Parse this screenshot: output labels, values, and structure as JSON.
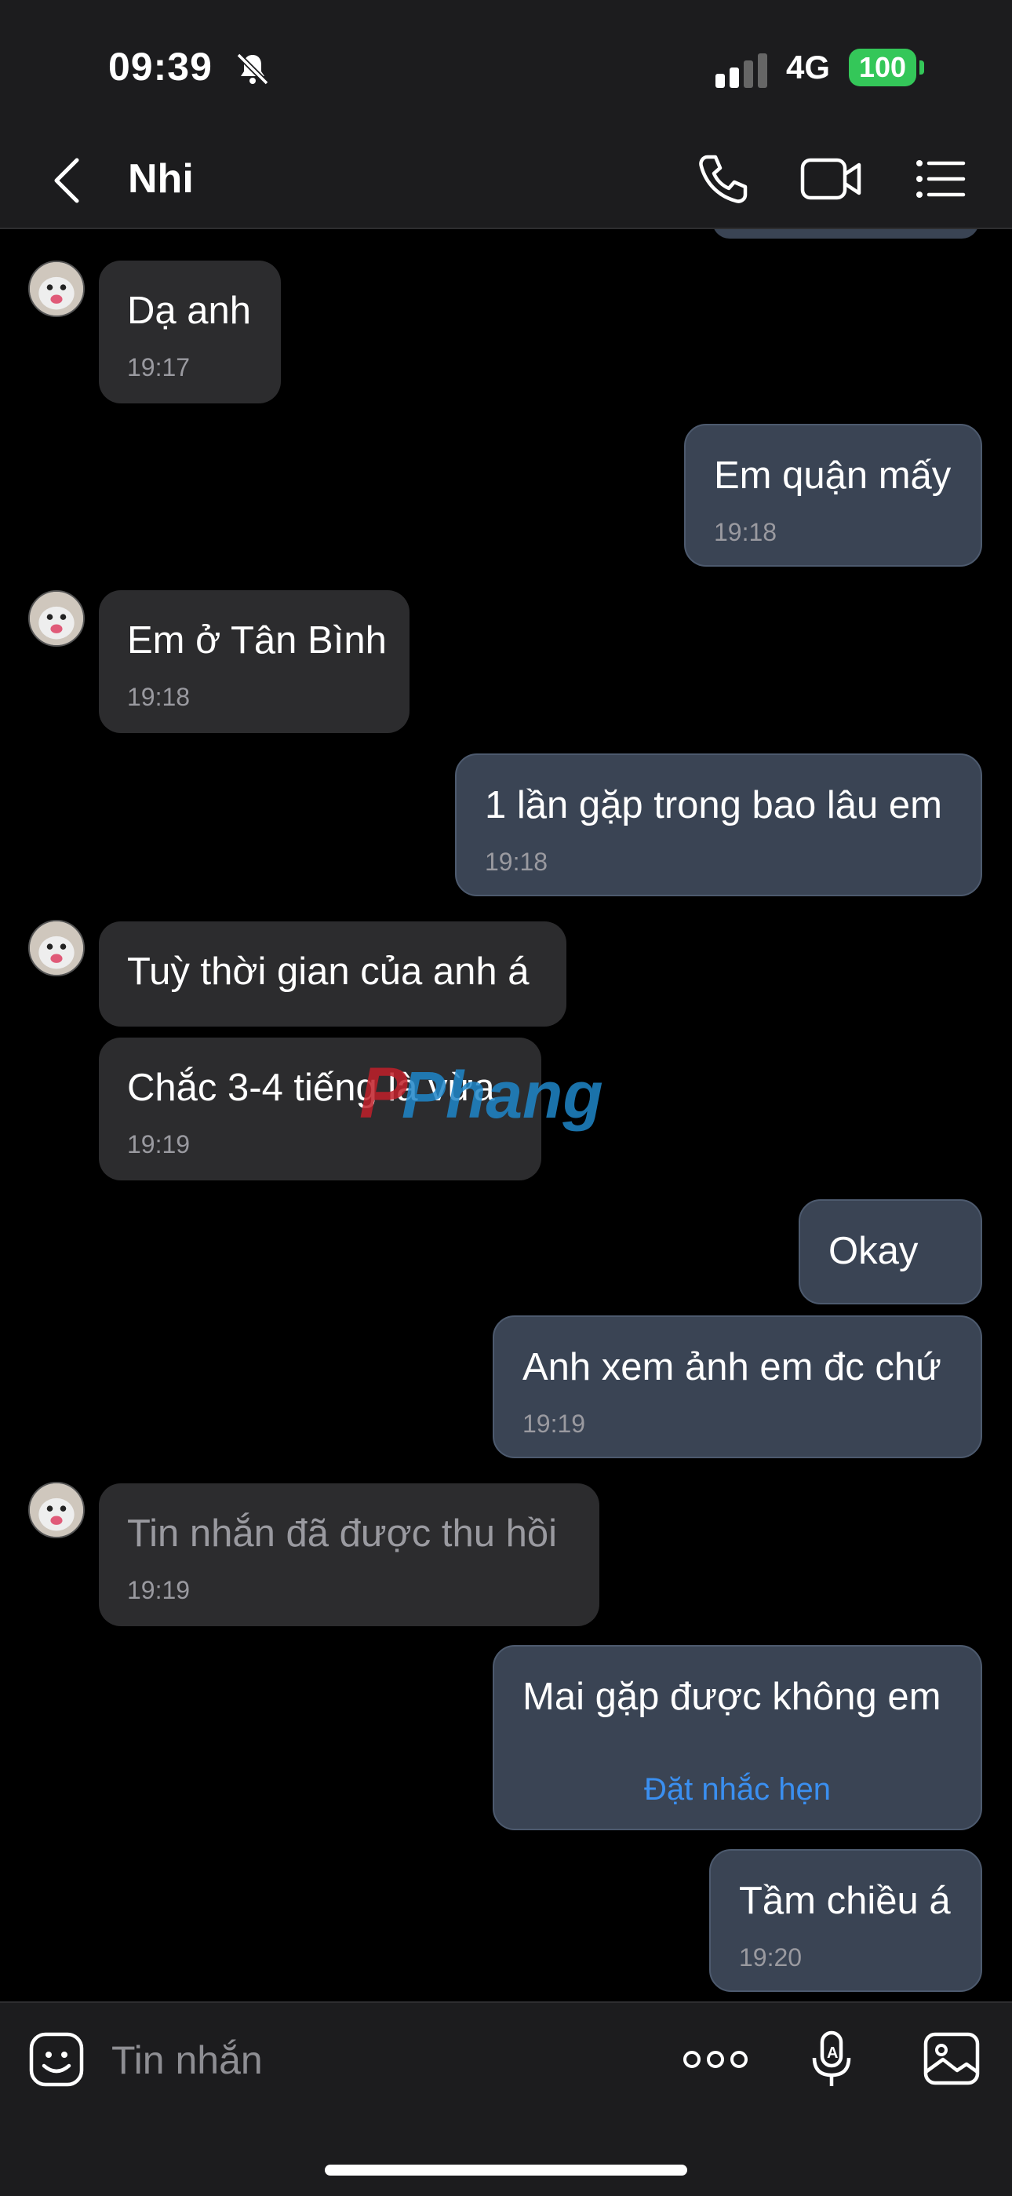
{
  "status_bar": {
    "time": "09:39",
    "network": "4G",
    "battery": "100"
  },
  "header": {
    "contact_name": "Nhi"
  },
  "messages": [
    {
      "dir": "in",
      "text": "Dạ anh",
      "time": "19:17"
    },
    {
      "dir": "out",
      "text": "Em quận mấy",
      "time": "19:18"
    },
    {
      "dir": "in",
      "text": "Em ở Tân Bình",
      "time": "19:18"
    },
    {
      "dir": "out",
      "text": "1 lần gặp trong bao lâu em",
      "time": "19:18"
    },
    {
      "dir": "in",
      "text": "Tuỳ thời gian của anh á"
    },
    {
      "dir": "in",
      "text": "Chắc 3-4 tiếng là vừa",
      "time": "19:19"
    },
    {
      "dir": "out",
      "text": "Okay"
    },
    {
      "dir": "out",
      "text": "Anh xem ảnh em đc chứ",
      "time": "19:19"
    },
    {
      "dir": "in",
      "text": "Tin nhắn đã được thu hồi",
      "time": "19:19",
      "recalled": true
    },
    {
      "dir": "out",
      "text": "Mai gặp được không em",
      "action": "Đặt nhắc hẹn"
    },
    {
      "dir": "out",
      "text": "Tầm chiều á",
      "time": "19:20"
    }
  ],
  "watermark": "Phang",
  "composer": {
    "placeholder": "Tin nhắn"
  },
  "colors": {
    "incoming": "#2c2c2e",
    "outgoing": "#3a4454",
    "link": "#3a8ff0",
    "battery": "#34c759"
  }
}
